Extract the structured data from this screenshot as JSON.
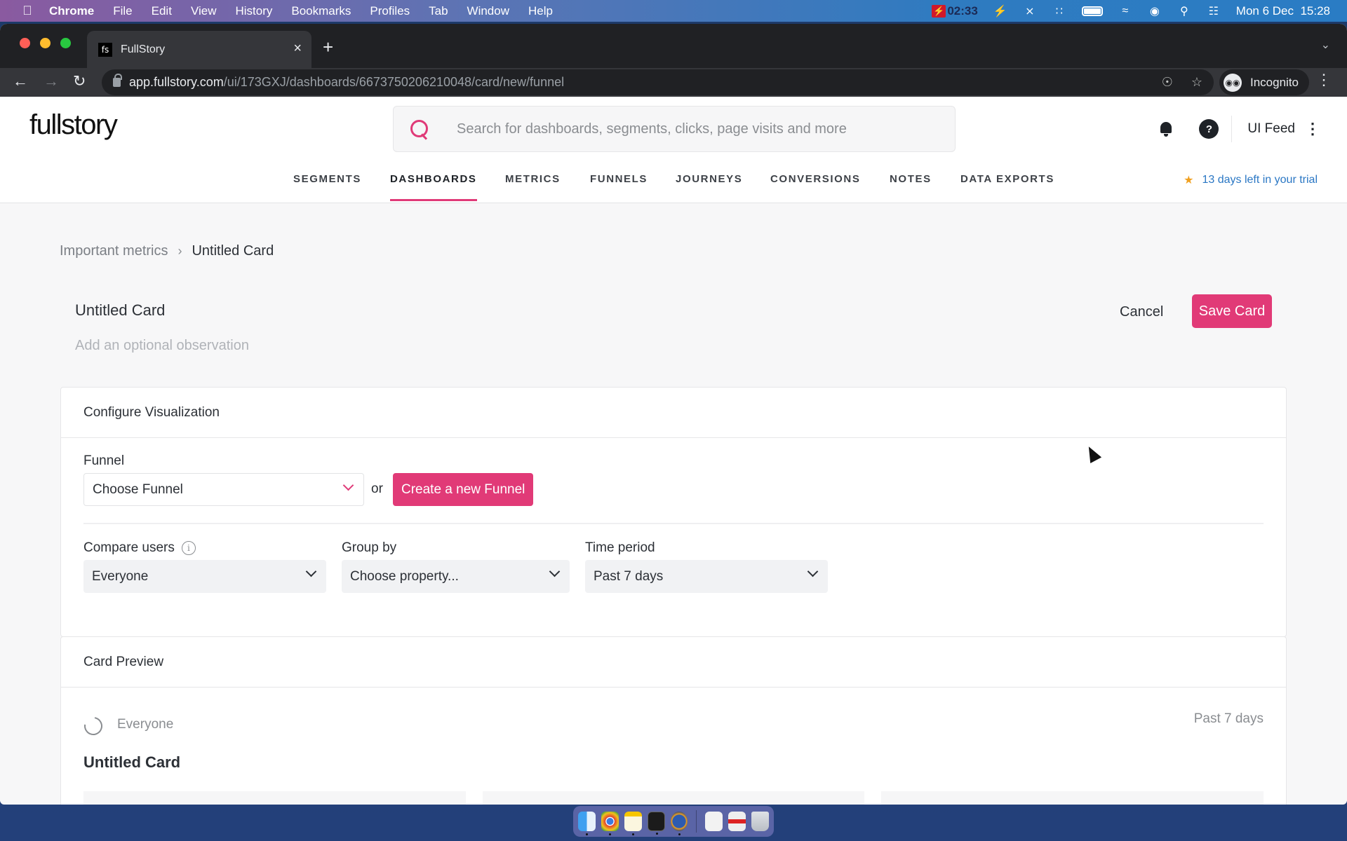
{
  "menubar": {
    "apple_icon": "apple-logo-icon",
    "items": [
      "Chrome",
      "File",
      "Edit",
      "View",
      "History",
      "Bookmarks",
      "Profiles",
      "Tab",
      "Window",
      "Help"
    ],
    "recording_timer": "02:33",
    "status_icons": [
      "flash-icon",
      "bluetooth-off-icon",
      "keyboard-brightness-icon",
      "battery-icon",
      "wifi-icon",
      "user-icon",
      "spotlight-search-icon",
      "control-center-icon"
    ],
    "datetime": "Mon 6 Dec  15:28"
  },
  "browser": {
    "tab_title": "FullStory",
    "tab_favicon": "fs",
    "url_host": "app.fullstory.com",
    "url_path": "/ui/173GXJ/dashboards/6673750206210048/card/new/funnel",
    "profile_label": "Incognito"
  },
  "header": {
    "logo": "fullstory",
    "search_placeholder": "Search for dashboards, segments, clicks, page visits and more",
    "account_label": "UI Feed"
  },
  "nav": {
    "items": [
      {
        "label": "SEGMENTS",
        "active": false
      },
      {
        "label": "DASHBOARDS",
        "active": true
      },
      {
        "label": "METRICS",
        "active": false
      },
      {
        "label": "FUNNELS",
        "active": false
      },
      {
        "label": "JOURNEYS",
        "active": false
      },
      {
        "label": "CONVERSIONS",
        "active": false
      },
      {
        "label": "NOTES",
        "active": false
      },
      {
        "label": "DATA EXPORTS",
        "active": false
      }
    ],
    "trial_text": "13 days left in your trial"
  },
  "breadcrumb": {
    "parent": "Important metrics",
    "current": "Untitled Card"
  },
  "card": {
    "title": "Untitled Card",
    "observation_placeholder": "Add an optional observation",
    "cancel_label": "Cancel",
    "save_label": "Save Card"
  },
  "configure": {
    "heading": "Configure Visualization",
    "funnel_label": "Funnel",
    "funnel_value": "Choose Funnel",
    "or_text": "or",
    "create_funnel_label": "Create a new Funnel",
    "compare_label": "Compare users",
    "compare_value": "Everyone",
    "group_label": "Group by",
    "group_value": "Choose property...",
    "time_label": "Time period",
    "time_value": "Past 7 days"
  },
  "preview": {
    "heading": "Card Preview",
    "segment": "Everyone",
    "time_period": "Past 7 days",
    "title": "Untitled Card"
  },
  "colors": {
    "accent": "#e13a77",
    "link": "#2a77c4",
    "star": "#f0a020"
  },
  "dock": {
    "apps": [
      "finder-icon",
      "chrome-icon",
      "notes-icon",
      "terminal-icon",
      "reeder-icon",
      "document-icon",
      "screenshot-icon",
      "trash-icon"
    ]
  }
}
